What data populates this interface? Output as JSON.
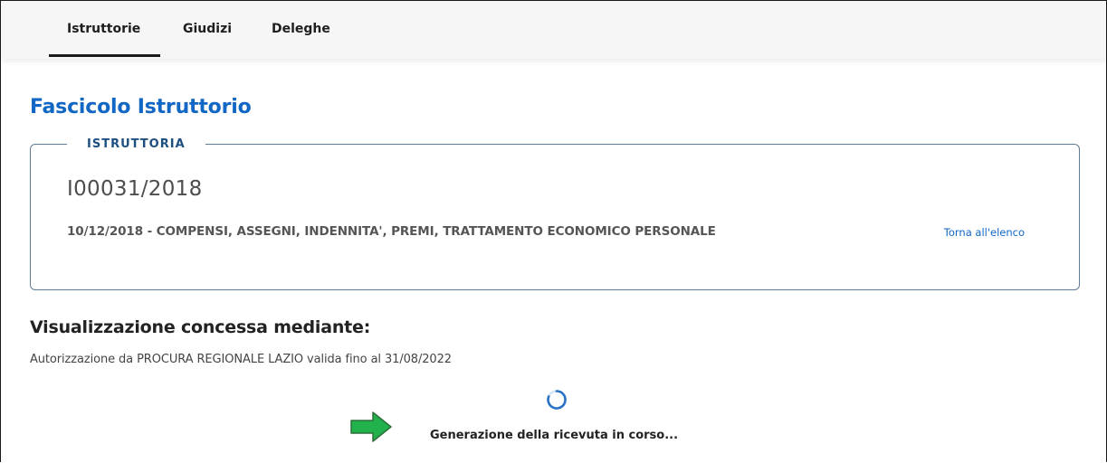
{
  "nav": {
    "tabs": [
      {
        "label": "Istruttorie",
        "active": true
      },
      {
        "label": "Giudizi",
        "active": false
      },
      {
        "label": "Deleghe",
        "active": false
      }
    ]
  },
  "page": {
    "title": "Fascicolo Istruttorio"
  },
  "istruttoria": {
    "legend": "ISTRUTTORIA",
    "case_id": "I00031/2018",
    "description": "10/12/2018 - COMPENSI, ASSEGNI, INDENNITA', PREMI, TRATTAMENTO ECONOMICO PERSONALE",
    "back_link": "Torna all'elenco"
  },
  "visualizzazione": {
    "heading": "Visualizzazione concessa mediante:",
    "authorization": "Autorizzazione da PROCURA REGIONALE LAZIO valida fino al 31/08/2022"
  },
  "loading": {
    "text": "Generazione della ricevuta in corso...",
    "spinner_icon": "loading-spinner-icon",
    "arrow_icon": "green-arrow-right-icon"
  },
  "colors": {
    "accent_blue": "#1266c4",
    "legend_blue": "#1d4f80",
    "arrow_green": "#22b14c",
    "spinner_blue": "#2a72c6"
  }
}
